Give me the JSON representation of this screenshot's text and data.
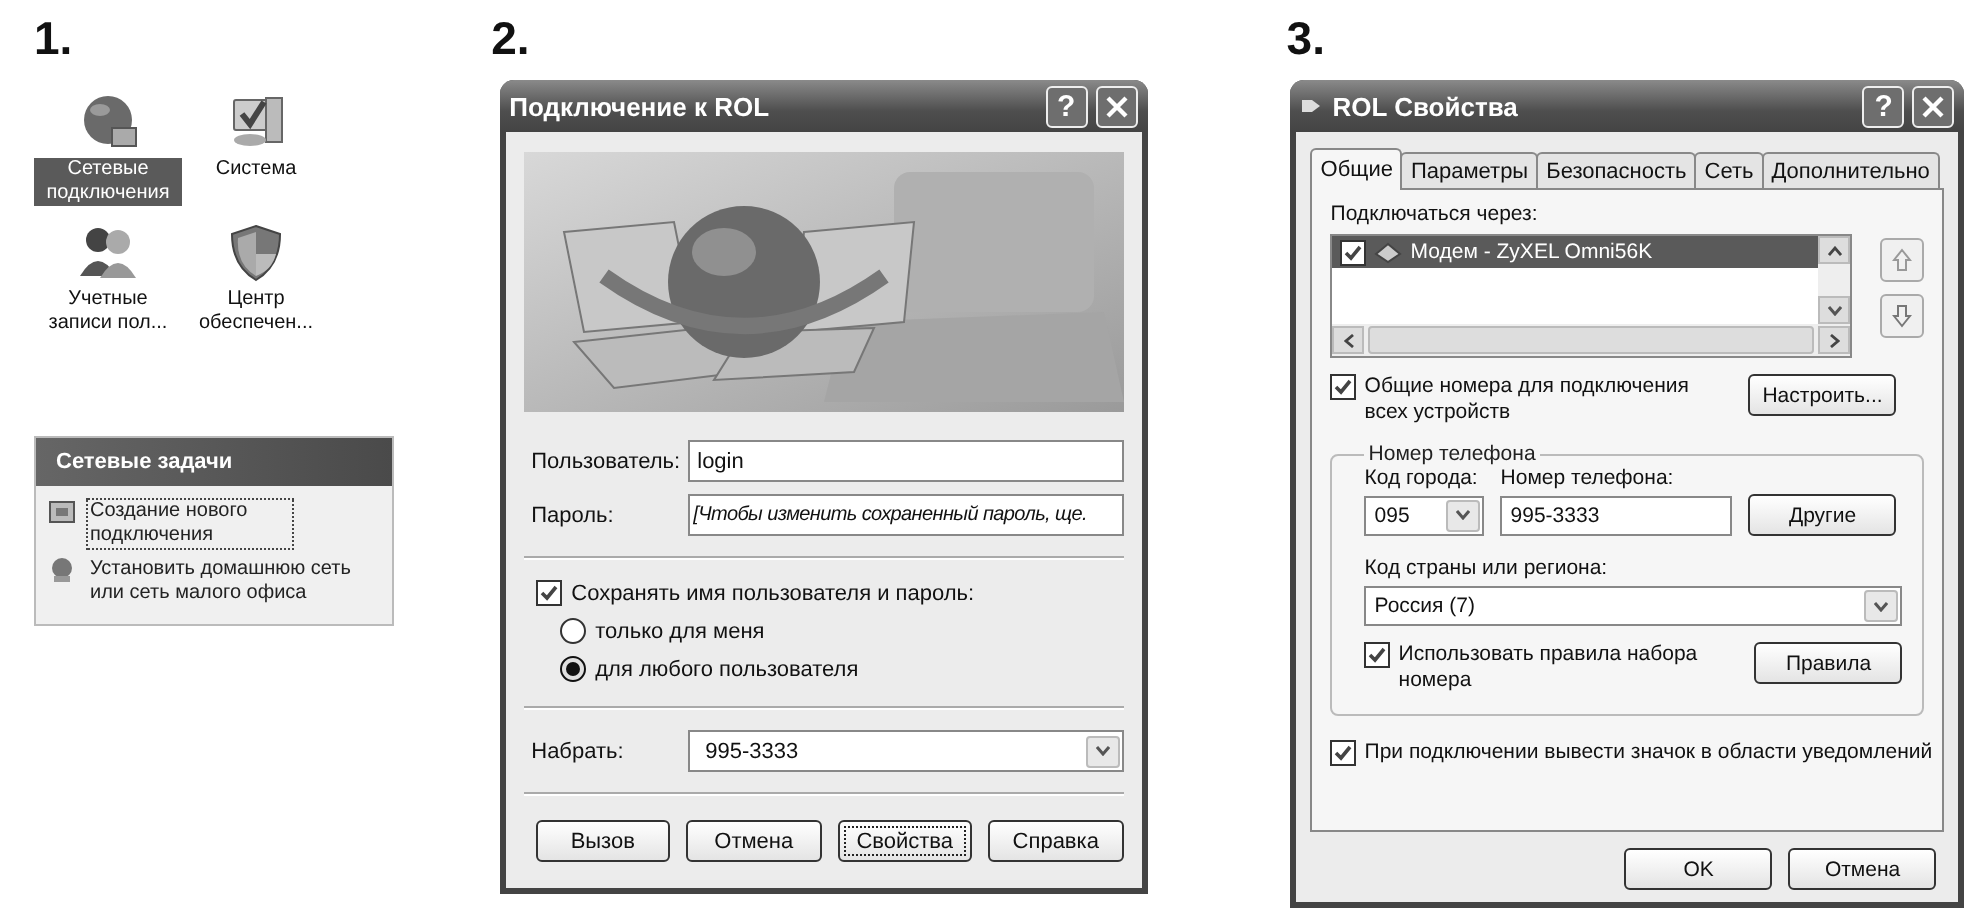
{
  "panel_1": {
    "number": "1.",
    "icons": [
      {
        "label": "Сетевые подключения",
        "kind": "network",
        "selected": true
      },
      {
        "label": "Система",
        "kind": "system",
        "selected": false
      },
      {
        "label": "Учетные записи пол...",
        "kind": "accounts",
        "selected": false
      },
      {
        "label": "Центр обеспечен...",
        "kind": "security",
        "selected": false
      }
    ],
    "tasks": {
      "title": "Сетевые задачи",
      "items": [
        {
          "label": "Создание нового подключения",
          "kind": "wizard",
          "focused": true
        },
        {
          "label": "Установить домашнюю сеть или сеть малого офиса",
          "kind": "home",
          "focused": false
        }
      ]
    }
  },
  "panel_2": {
    "number": "2.",
    "dialog": {
      "title": "Подключение к ROL",
      "help_button": "?",
      "user_label": "Пользователь:",
      "user_value": "login",
      "password_label": "Пароль:",
      "password_value": "[Чтобы изменить сохраненный пароль, ще.",
      "save_checkbox": {
        "label": "Сохранять имя пользователя и пароль:",
        "checked": true
      },
      "radios": [
        {
          "label": "только для меня",
          "selected": false
        },
        {
          "label": "для любого пользователя",
          "selected": true
        }
      ],
      "dial_label": "Набрать:",
      "dial_value": "995-3333",
      "buttons": [
        {
          "label": "Вызов",
          "focused": false
        },
        {
          "label": "Отмена",
          "focused": false
        },
        {
          "label": "Свойства",
          "focused": true
        },
        {
          "label": "Справка",
          "focused": false
        }
      ]
    }
  },
  "panel_3": {
    "number": "3.",
    "dialog": {
      "title": "ROL Свойства",
      "help_button": "?",
      "tabs": [
        {
          "label": "Общие",
          "selected": true
        },
        {
          "label": "Параметры",
          "selected": false
        },
        {
          "label": "Безопасность",
          "selected": false
        },
        {
          "label": "Сеть",
          "selected": false
        },
        {
          "label": "Дополнительно",
          "selected": false
        }
      ],
      "connect_via_label": "Подключаться через:",
      "devices": [
        {
          "label": "Модем - ZyXEL Omni56K",
          "checked": true,
          "selected": true
        }
      ],
      "shared_numbers": {
        "label": "Общие номера для подключения всех устройств",
        "checked": true
      },
      "configure_button": "Настроить...",
      "phone_group": {
        "title": "Номер телефона",
        "area_code_label": "Код города:",
        "area_code_value": "095",
        "phone_label": "Номер телефона:",
        "phone_value": "995-3333",
        "others_button": "Другие",
        "country_label": "Код страны или региона:",
        "country_value": "Россия (7)",
        "dialing_rules": {
          "label": "Использовать правила набора номера",
          "checked": true
        },
        "rules_button": "Правила"
      },
      "tray_icon": {
        "label": "При подключении вывести значок в области уведомлений",
        "checked": true
      },
      "buttons": [
        "OK",
        "Отмена"
      ]
    }
  }
}
